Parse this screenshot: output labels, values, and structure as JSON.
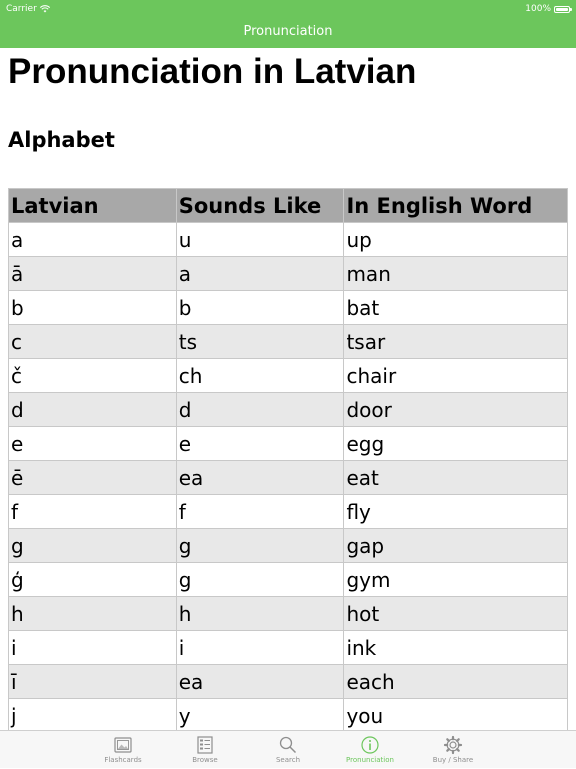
{
  "status_bar": {
    "carrier": "Carrier",
    "time": "",
    "battery_percent": "100%"
  },
  "nav": {
    "title": "Pronunciation"
  },
  "page": {
    "title": "Pronunciation in Latvian",
    "section_title": "Alphabet"
  },
  "table": {
    "headers": [
      "Latvian",
      "Sounds Like",
      "In English Word"
    ],
    "rows": [
      [
        "a",
        "u",
        "up"
      ],
      [
        "ā",
        "a",
        "man"
      ],
      [
        "b",
        "b",
        "bat"
      ],
      [
        "c",
        "ts",
        "tsar"
      ],
      [
        "č",
        "ch",
        "chair"
      ],
      [
        "d",
        "d",
        "door"
      ],
      [
        "e",
        "e",
        "egg"
      ],
      [
        "ē",
        "ea",
        "eat"
      ],
      [
        "f",
        "f",
        "fly"
      ],
      [
        "g",
        "g",
        "gap"
      ],
      [
        "ģ",
        "g",
        "gym"
      ],
      [
        "h",
        "h",
        "hot"
      ],
      [
        "i",
        "i",
        "ink"
      ],
      [
        "ī",
        "ea",
        "each"
      ],
      [
        "j",
        "y",
        "you"
      ]
    ]
  },
  "tabbar": {
    "items": [
      {
        "label": "Flashcards",
        "icon": "flashcards-icon"
      },
      {
        "label": "Browse",
        "icon": "browse-icon"
      },
      {
        "label": "Search",
        "icon": "search-icon"
      },
      {
        "label": "Pronunciation",
        "icon": "info-icon"
      },
      {
        "label": "Buy / Share",
        "icon": "gear-icon"
      }
    ],
    "active_index": 3
  },
  "colors": {
    "accent": "#6cc65c",
    "header_row": "#a8a8a8",
    "alt_row": "#e8e8e8",
    "tab_inactive": "#8e8e8e"
  }
}
